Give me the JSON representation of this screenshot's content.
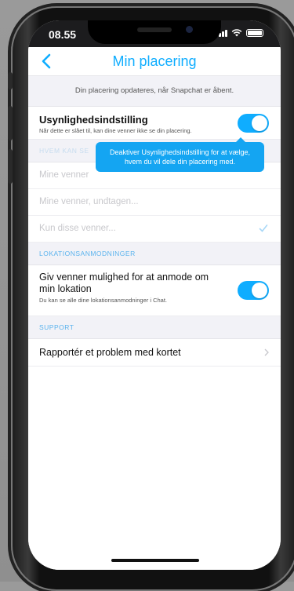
{
  "status": {
    "time": "08.55"
  },
  "nav": {
    "title": "Min placering"
  },
  "info_text": "Din placering opdateres, når Snapchat er åbent.",
  "ghost_mode": {
    "title": "Usynlighedsindstilling",
    "subtitle": "Når dette er slået til, kan dine venner ikke se din placering.",
    "enabled": true
  },
  "tooltip": {
    "line1": "Deaktiver Usynlighedsindstilling for at vælge,",
    "line2": "hvem du vil dele din placering med."
  },
  "who_can_see": {
    "header": "HVEM KAN SE",
    "options": [
      "Mine venner",
      "Mine venner, undtagen...",
      "Kun disse venner..."
    ],
    "selected_index": 2
  },
  "location_requests": {
    "header": "LOKATIONSANMODNINGER",
    "title_line1": "Giv venner mulighed for at anmode om",
    "title_line2": "min lokation",
    "subtitle": "Du kan se alle dine lokationsanmodninger i Chat.",
    "enabled": true
  },
  "support": {
    "header": "SUPPORT",
    "report_label": "Rapportér et problem med kortet"
  },
  "colors": {
    "accent": "#0fadff",
    "tooltip": "#14a5f2",
    "section_text": "#5ab3ee"
  }
}
